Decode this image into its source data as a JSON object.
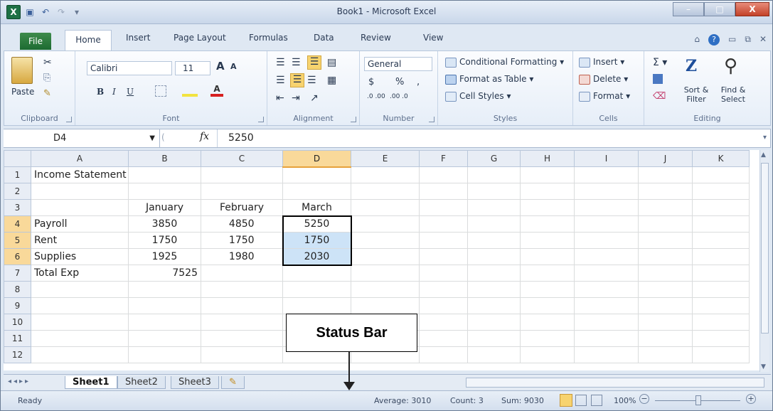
{
  "window": {
    "title": "Book1  -  Microsoft Excel",
    "logo": "X",
    "min_label": "–",
    "max_label": "□",
    "close_label": "X"
  },
  "tabs": {
    "file": "File",
    "items": [
      "Home",
      "Insert",
      "Page Layout",
      "Formulas",
      "Data",
      "Review",
      "View"
    ]
  },
  "ribbon": {
    "clipboard": {
      "label": "Clipboard",
      "paste": "Paste"
    },
    "font": {
      "label": "Font",
      "name": "Calibri",
      "size": "11",
      "bold": "B",
      "italic": "I",
      "underline": "U",
      "grow": "A",
      "shrink": "A"
    },
    "alignment": {
      "label": "Alignment"
    },
    "number": {
      "label": "Number",
      "format": "General",
      "currency": "$",
      "percent": "%",
      "comma": ",",
      "inc": ".0 .00",
      "dec": ".00 .0"
    },
    "styles": {
      "label": "Styles",
      "conditional": "Conditional Formatting",
      "table": "Format as Table",
      "cell": "Cell Styles"
    },
    "cells": {
      "label": "Cells",
      "insert": "Insert",
      "delete": "Delete",
      "format": "Format"
    },
    "editing": {
      "label": "Editing",
      "sum": "Σ",
      "sort": "Sort & Filter",
      "find": "Find & Select"
    }
  },
  "formula_bar": {
    "name_box": "D4",
    "fx": "fx",
    "value": "5250"
  },
  "grid": {
    "columns": [
      "A",
      "B",
      "C",
      "D",
      "E",
      "F",
      "G",
      "H",
      "I",
      "J",
      "K"
    ],
    "rows": [
      {
        "num": "1",
        "A": "Income Statement",
        "B": "",
        "C": "",
        "D": ""
      },
      {
        "num": "2",
        "A": "",
        "B": "",
        "C": "",
        "D": ""
      },
      {
        "num": "3",
        "A": "",
        "B": "January",
        "C": "February",
        "D": "March"
      },
      {
        "num": "4",
        "A": "Payroll",
        "B": "3850",
        "C": "4850",
        "D": "5250"
      },
      {
        "num": "5",
        "A": "Rent",
        "B": "1750",
        "C": "1750",
        "D": "1750"
      },
      {
        "num": "6",
        "A": "Supplies",
        "B": "1925",
        "C": "1980",
        "D": "2030"
      },
      {
        "num": "7",
        "A": "Total Exp",
        "B": "7525",
        "C": "",
        "D": ""
      },
      {
        "num": "8",
        "A": "",
        "B": "",
        "C": "",
        "D": ""
      },
      {
        "num": "9",
        "A": "",
        "B": "",
        "C": "",
        "D": ""
      },
      {
        "num": "10",
        "A": "",
        "B": "",
        "C": "",
        "D": ""
      },
      {
        "num": "11",
        "A": "",
        "B": "",
        "C": "",
        "D": ""
      },
      {
        "num": "12",
        "A": "",
        "B": "",
        "C": "",
        "D": ""
      }
    ]
  },
  "sheets": [
    "Sheet1",
    "Sheet2",
    "Sheet3"
  ],
  "status": {
    "ready": "Ready",
    "average": "Average: 3010",
    "count": "Count: 3",
    "sum": "Sum: 9030",
    "zoom": "100%"
  },
  "callout": "Status Bar"
}
